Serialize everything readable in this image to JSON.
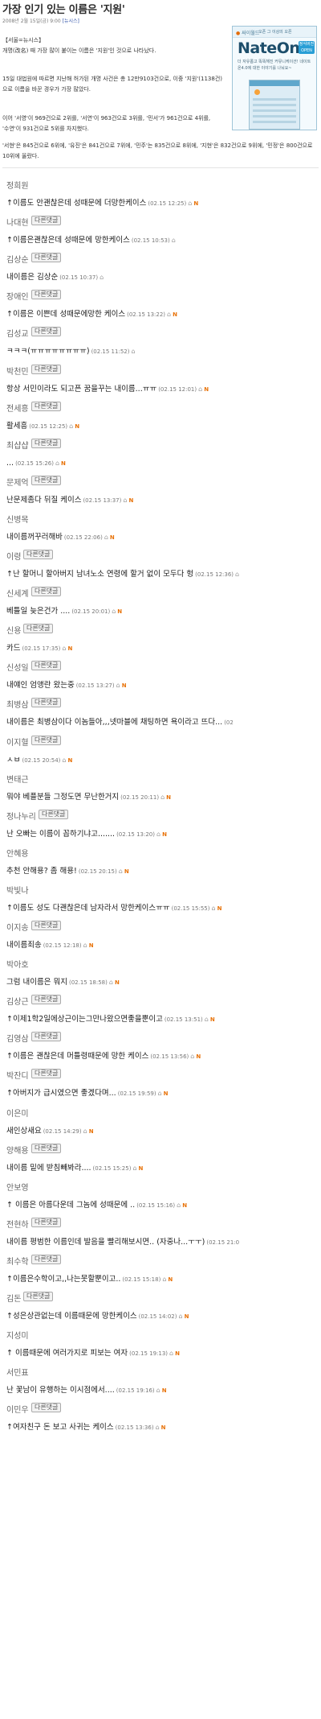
{
  "article": {
    "title": "가장 인기 있는 이름은 '지원'",
    "date": "2008년 2월 15일(금) 9:00",
    "source": "[뉴시스]",
    "paragraphs": [
      "【서울=뉴시스】",
      "개명(改名) 때 가장 많이 붙이는 이름은 '지원'인 것으로 나타났다.",
      "15일 대법원에 따르면 지난해 허가된 개명 사건은 총 12만9103건으로, 이중 '지원'(1138건)으로 이름을 바꾼 경우가 가장 많았다.",
      "이어 '서영'이 969건으로 2위를, '서연'이 963건으로 3위를, '민서'가 961건으로 4위를, '수연'이 931건으로 5위를 차지했다.",
      "'서현'은 845건으로 6위에, '유진'은 841건으로 7위에, '민주'는 835건으로 8위에, '지현'은 832건으로 9위에, '민정'은 800건으로 10위에 올랐다."
    ]
  },
  "ad": {
    "logo": "싸이월드",
    "tagline": "오픈 그 이상의 오픈",
    "product": "NateOn 4.0",
    "badge": "정식버전 OPEN",
    "copy": "더 자유롭고 똑똑해진 커뮤니케이션! 네이트온4.0에 대한 이야기를 나눠요~"
  },
  "reply_label": "다른댓글",
  "comments": [
    {
      "name": "정희원",
      "reply": false,
      "text": "↑이름도 안괜찮은데 성때문에 더망한케이스",
      "date": "(02.15 12:25)",
      "lock": true,
      "flag": true
    },
    {
      "name": "나대현",
      "reply": true,
      "text": "↑이름은괜찮은데 성때문에 망한케이스",
      "date": "(02.15 10:53)",
      "lock": true,
      "flag": false
    },
    {
      "name": "김상순",
      "reply": true,
      "text": "내이름은 김상순",
      "date": "(02.15 10:37)",
      "lock": true,
      "flag": false
    },
    {
      "name": "장애인",
      "reply": true,
      "text": "↑이름은 이쁜데 성때문에망한 케이스",
      "date": "(02.15 13:22)",
      "lock": true,
      "flag": true
    },
    {
      "name": "김성교",
      "reply": true,
      "text": "ㅋㅋㅋ(ㅠㅠㅠㅠㅠㅠㅠㅠ)",
      "date": "(02.15 11:52)",
      "lock": true,
      "flag": false
    },
    {
      "name": "박천민",
      "reply": true,
      "text": "항상 서민이라도 되고픈 꿈을꾸는 내이름...ㅠㅠ",
      "date": "(02.15 12:01)",
      "lock": true,
      "flag": true
    },
    {
      "name": "전세흥",
      "reply": true,
      "text": "활세흥",
      "date": "(02.15 12:25)",
      "lock": true,
      "flag": true
    },
    {
      "name": "최샵샵",
      "reply": true,
      "text": "...",
      "date": "(02.15 15:26)",
      "lock": true,
      "flag": true
    },
    {
      "name": "문제억",
      "reply": true,
      "text": "난문제좀다 뒤질 케이스",
      "date": "(02.15 13:37)",
      "lock": true,
      "flag": true
    },
    {
      "name": "신병목",
      "reply": false,
      "text": "내이름꺼꾸러해바",
      "date": "(02.15 22:06)",
      "lock": true,
      "flag": true
    },
    {
      "name": "이령",
      "reply": true,
      "text": "↑난 할머니 할아버지 남녀노소 연령에 할거 없이 모두다 헝",
      "date": "(02.15 12:36)",
      "lock": true,
      "flag": false
    },
    {
      "name": "신세계",
      "reply": true,
      "text": "베틀일 늦은건가 ....",
      "date": "(02.15 20:01)",
      "lock": true,
      "flag": true
    },
    {
      "name": "신용",
      "reply": true,
      "text": "카드",
      "date": "(02.15 17:35)",
      "lock": true,
      "flag": true
    },
    {
      "name": "신성일",
      "reply": true,
      "text": "내얘인 엄앵란 왔는중",
      "date": "(02.15 13:27)",
      "lock": true,
      "flag": true
    },
    {
      "name": "최병삼",
      "reply": true,
      "text": "내이름은 최병삼이다 이놈들아,,,넷마블에 채팅하면 욕이라고 뜨다...",
      "date": "(02",
      "lock": false,
      "flag": false
    },
    {
      "name": "이지혈",
      "reply": true,
      "text": "ㅅㅂ",
      "date": "(02.15 20:54)",
      "lock": true,
      "flag": true
    },
    {
      "name": "변태근",
      "reply": false,
      "text": "뭐야 베플분들 그정도면 무난한거지",
      "date": "(02.15 20:11)",
      "lock": true,
      "flag": true
    },
    {
      "name": "정나누리",
      "reply": true,
      "text": "난 오빠는 이름이 꼽하기냐고.......",
      "date": "(02.15 13:20)",
      "lock": true,
      "flag": true
    },
    {
      "name": "안혜용",
      "reply": false,
      "text": "추천 안해용? 좀 해용!",
      "date": "(02.15 20:15)",
      "lock": true,
      "flag": true
    },
    {
      "name": "박빛나",
      "reply": false,
      "text": "↑이름도 성도 다괜찮은데 남자라서 망한케이스ㅠㅠ",
      "date": "(02.15 15:55)",
      "lock": true,
      "flag": true
    },
    {
      "name": "이지송",
      "reply": true,
      "text": "내이름죄송",
      "date": "(02.15 12:18)",
      "lock": true,
      "flag": true
    },
    {
      "name": "박아호",
      "reply": false,
      "text": "그럼 내이름은 뭐지",
      "date": "(02.15 18:58)",
      "lock": true,
      "flag": true
    },
    {
      "name": "김상근",
      "reply": true,
      "text": "↑이제1학2일에상근이는그만나왔으면좋을뿐이고",
      "date": "(02.15 13:51)",
      "lock": true,
      "flag": true
    },
    {
      "name": "김영삼",
      "reply": true,
      "text": "↑이름은 괜찮은데 머틀령때문에 망한 케이스",
      "date": "(02.15 13:56)",
      "lock": true,
      "flag": true
    },
    {
      "name": "박잔디",
      "reply": true,
      "text": "↑아버지가 급시였으면 좋겠다며...",
      "date": "(02.15 19:59)",
      "lock": true,
      "flag": true
    },
    {
      "name": "이은미",
      "reply": false,
      "text": "새인상새요",
      "date": "(02.15 14:29)",
      "lock": true,
      "flag": true
    },
    {
      "name": "양해용",
      "reply": true,
      "text": "내이름 밑에 받침빼봐라....",
      "date": "(02.15 15:25)",
      "lock": true,
      "flag": true
    },
    {
      "name": "안보영",
      "reply": false,
      "text": "↑ 이름은 아름다운데 그놈에 성때문에 ..",
      "date": "(02.15 15:16)",
      "lock": true,
      "flag": true
    },
    {
      "name": "전현하",
      "reply": true,
      "text": "내이름 평범한 이름인데 발음을 빨리해보시면.. (자중나...ㅜㅜ)",
      "date": "(02.15 21:0",
      "lock": false,
      "flag": false
    },
    {
      "name": "최수학",
      "reply": true,
      "text": "↑이름은수학이고,,나는못할뿐이고..",
      "date": "(02.15 15:18)",
      "lock": true,
      "flag": true
    },
    {
      "name": "김돈",
      "reply": true,
      "text": "↑성은상관없는데 이름때문에 망한케이스",
      "date": "(02.15 14:02)",
      "lock": true,
      "flag": true
    },
    {
      "name": "지성미",
      "reply": false,
      "text": "↑ 이름때문에 여러가지로 피보는 여자",
      "date": "(02.15 19:13)",
      "lock": true,
      "flag": true
    },
    {
      "name": "서민표",
      "reply": false,
      "text": "난 꽃남이 유행하는 이시점에서....",
      "date": "(02.15 19:16)",
      "lock": true,
      "flag": true
    },
    {
      "name": "이민우",
      "reply": true,
      "text": "↑여자친구 돈 보고 사귀는 케이스",
      "date": "(02.15 13:36)",
      "lock": true,
      "flag": true
    }
  ]
}
